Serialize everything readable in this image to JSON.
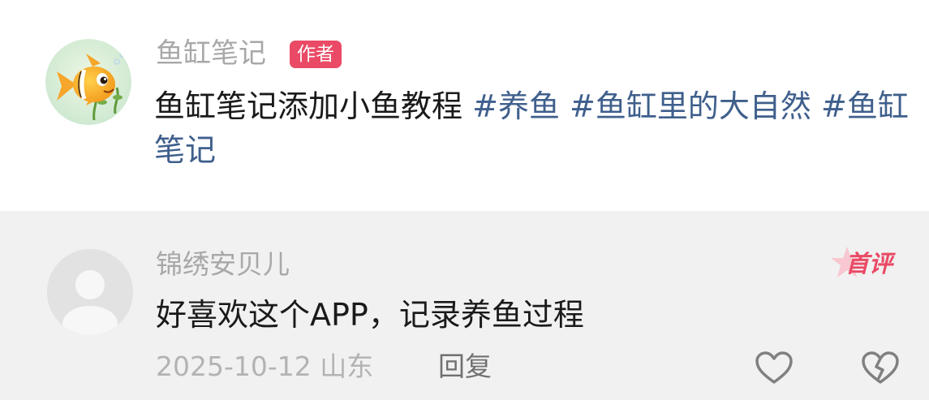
{
  "post": {
    "avatar_icon": "fish-avatar-icon",
    "author": "鱼缸笔记",
    "author_badge": "作者",
    "text": "鱼缸笔记添加小鱼教程",
    "tags": [
      "#养鱼",
      "#鱼缸里的大自然",
      "#鱼缸笔记"
    ]
  },
  "comment": {
    "avatar_icon": "default-user-avatar-icon",
    "username": "锦绣安贝儿",
    "first_badge": "首评",
    "text": "好喜欢这个APP，记录养鱼过程",
    "date_location": "2025-10-12 山东",
    "reply_label": "回复",
    "like_icon": "heart-icon",
    "dislike_icon": "broken-heart-icon"
  },
  "colors": {
    "tag": "#3f5f8c",
    "badge": "#ea4a65",
    "comment_bg": "#f1f1f1"
  }
}
